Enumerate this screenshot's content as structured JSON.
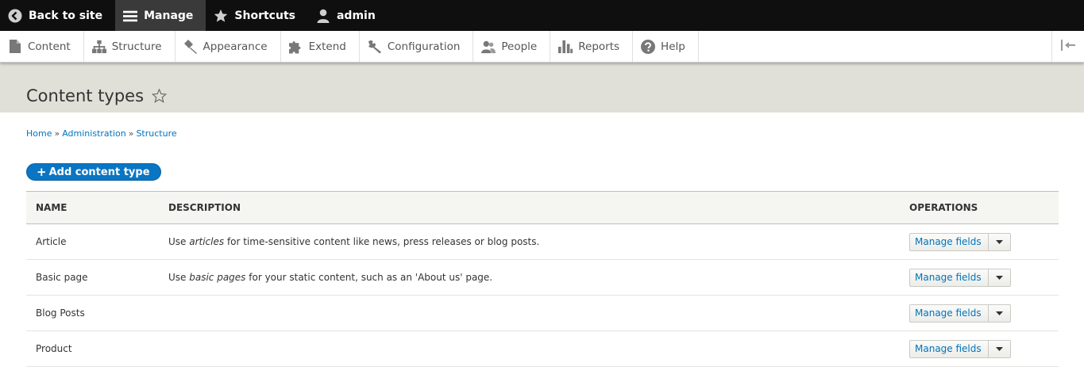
{
  "toolbar": {
    "items": [
      {
        "label": "Back to site",
        "icon": "back-arrow-circle-icon"
      },
      {
        "label": "Manage",
        "icon": "hamburger-menu-icon"
      },
      {
        "label": "Shortcuts",
        "icon": "star-icon"
      },
      {
        "label": "admin",
        "icon": "user-icon"
      }
    ]
  },
  "tray": {
    "items": [
      {
        "label": "Content",
        "icon": "document-icon"
      },
      {
        "label": "Structure",
        "icon": "sitemap-icon"
      },
      {
        "label": "Appearance",
        "icon": "paintbrush-icon"
      },
      {
        "label": "Extend",
        "icon": "puzzle-icon"
      },
      {
        "label": "Configuration",
        "icon": "wrench-icon"
      },
      {
        "label": "People",
        "icon": "people-icon"
      },
      {
        "label": "Reports",
        "icon": "bar-chart-icon"
      },
      {
        "label": "Help",
        "icon": "help-icon"
      }
    ]
  },
  "page": {
    "title": "Content types"
  },
  "breadcrumb": {
    "items": [
      "Home",
      "Administration",
      "Structure"
    ],
    "separator": "»"
  },
  "actions": {
    "add_label": "Add content type",
    "add_plus": "+"
  },
  "table": {
    "headers": {
      "name": "Name",
      "description": "Description",
      "operations": "Operations"
    },
    "rows": [
      {
        "name": "Article",
        "desc_pre": "Use ",
        "desc_em": "articles",
        "desc_post": " for time-sensitive content like news, press releases or blog posts.",
        "op": "Manage fields"
      },
      {
        "name": "Basic page",
        "desc_pre": "Use ",
        "desc_em": "basic pages",
        "desc_post": " for your static content, such as an 'About us' page.",
        "op": "Manage fields"
      },
      {
        "name": "Blog Posts",
        "desc_pre": "",
        "desc_em": "",
        "desc_post": "",
        "op": "Manage fields"
      },
      {
        "name": "Product",
        "desc_pre": "",
        "desc_em": "",
        "desc_post": "",
        "op": "Manage fields"
      }
    ]
  },
  "colors": {
    "toolbar_bg": "#0f0f0f",
    "link": "#0074bd",
    "primary_button": "#0a76c3",
    "header_bg": "#e0e0d8"
  }
}
